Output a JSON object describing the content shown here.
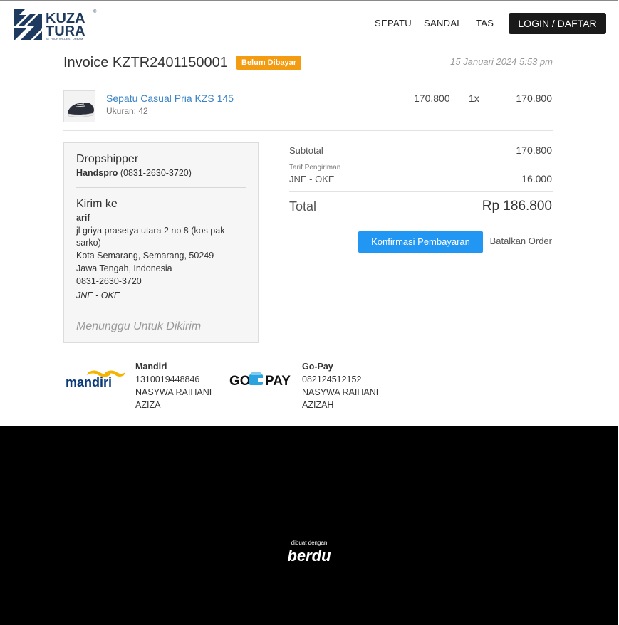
{
  "header": {
    "nav": [
      "SEPATU",
      "SANDAL",
      "TAS"
    ],
    "login_label": "LOGIN / DAFTAR",
    "logo_text_1": "KUZA",
    "logo_text_2": "TURA",
    "logo_tagline": "BE YOUR WILDEST DREAM"
  },
  "invoice": {
    "title": "Invoice KZTR2401150001",
    "status": "Belum Dibayar",
    "date": "15 Januari 2024 5:53 pm"
  },
  "item": {
    "name": "Sepatu Casual Pria KZS 145",
    "size": "Ukuran: 42",
    "price": "170.800",
    "qty": "1x",
    "total": "170.800"
  },
  "shipping": {
    "dropshipper_heading": "Dropshipper",
    "dropshipper_name": "Handspro",
    "dropshipper_phone": "(0831-2630-3720)",
    "kirim_heading": "Kirim ke",
    "recipient": "arif",
    "address_line1": "jl griya prasetya utara 2 no 8 (kos pak",
    "address_line2": "sarko)",
    "city": "Kota Semarang, Semarang, 50249",
    "province": "Jawa Tengah, Indonesia",
    "phone": "0831-2630-3720",
    "courier": "JNE - OKE",
    "status": "Menunggu Untuk Dikirim"
  },
  "totals": {
    "subtotal_label": "Subtotal",
    "subtotal": "170.800",
    "shipping_label": "Tarif Pengiriman",
    "shipping_service": "JNE - OKE",
    "shipping": "16.000",
    "total_label": "Total",
    "total": "Rp 186.800"
  },
  "actions": {
    "confirm": "Konfirmasi Pembayaran",
    "cancel": "Batalkan Order"
  },
  "banks": [
    {
      "name": "Mandiri",
      "logo_text": "mandiri",
      "account": "1310019448846",
      "holder1": "NASYWA RAIHANI",
      "holder2": "AZIZA"
    },
    {
      "name": "Go-Pay",
      "logo_text_go": "GO",
      "logo_text_pay": "PAY",
      "account": "082124512152",
      "holder1": "NASYWA RAIHANI",
      "holder2": "AZIZAH"
    }
  ],
  "footer": {
    "small": "dibuat dengan",
    "brand": "berdu"
  },
  "colors": {
    "accent_blue": "#2196f3",
    "link_blue": "#3a84c6",
    "badge_orange": "#f39c12",
    "logo_navy": "#1e3a5f"
  }
}
